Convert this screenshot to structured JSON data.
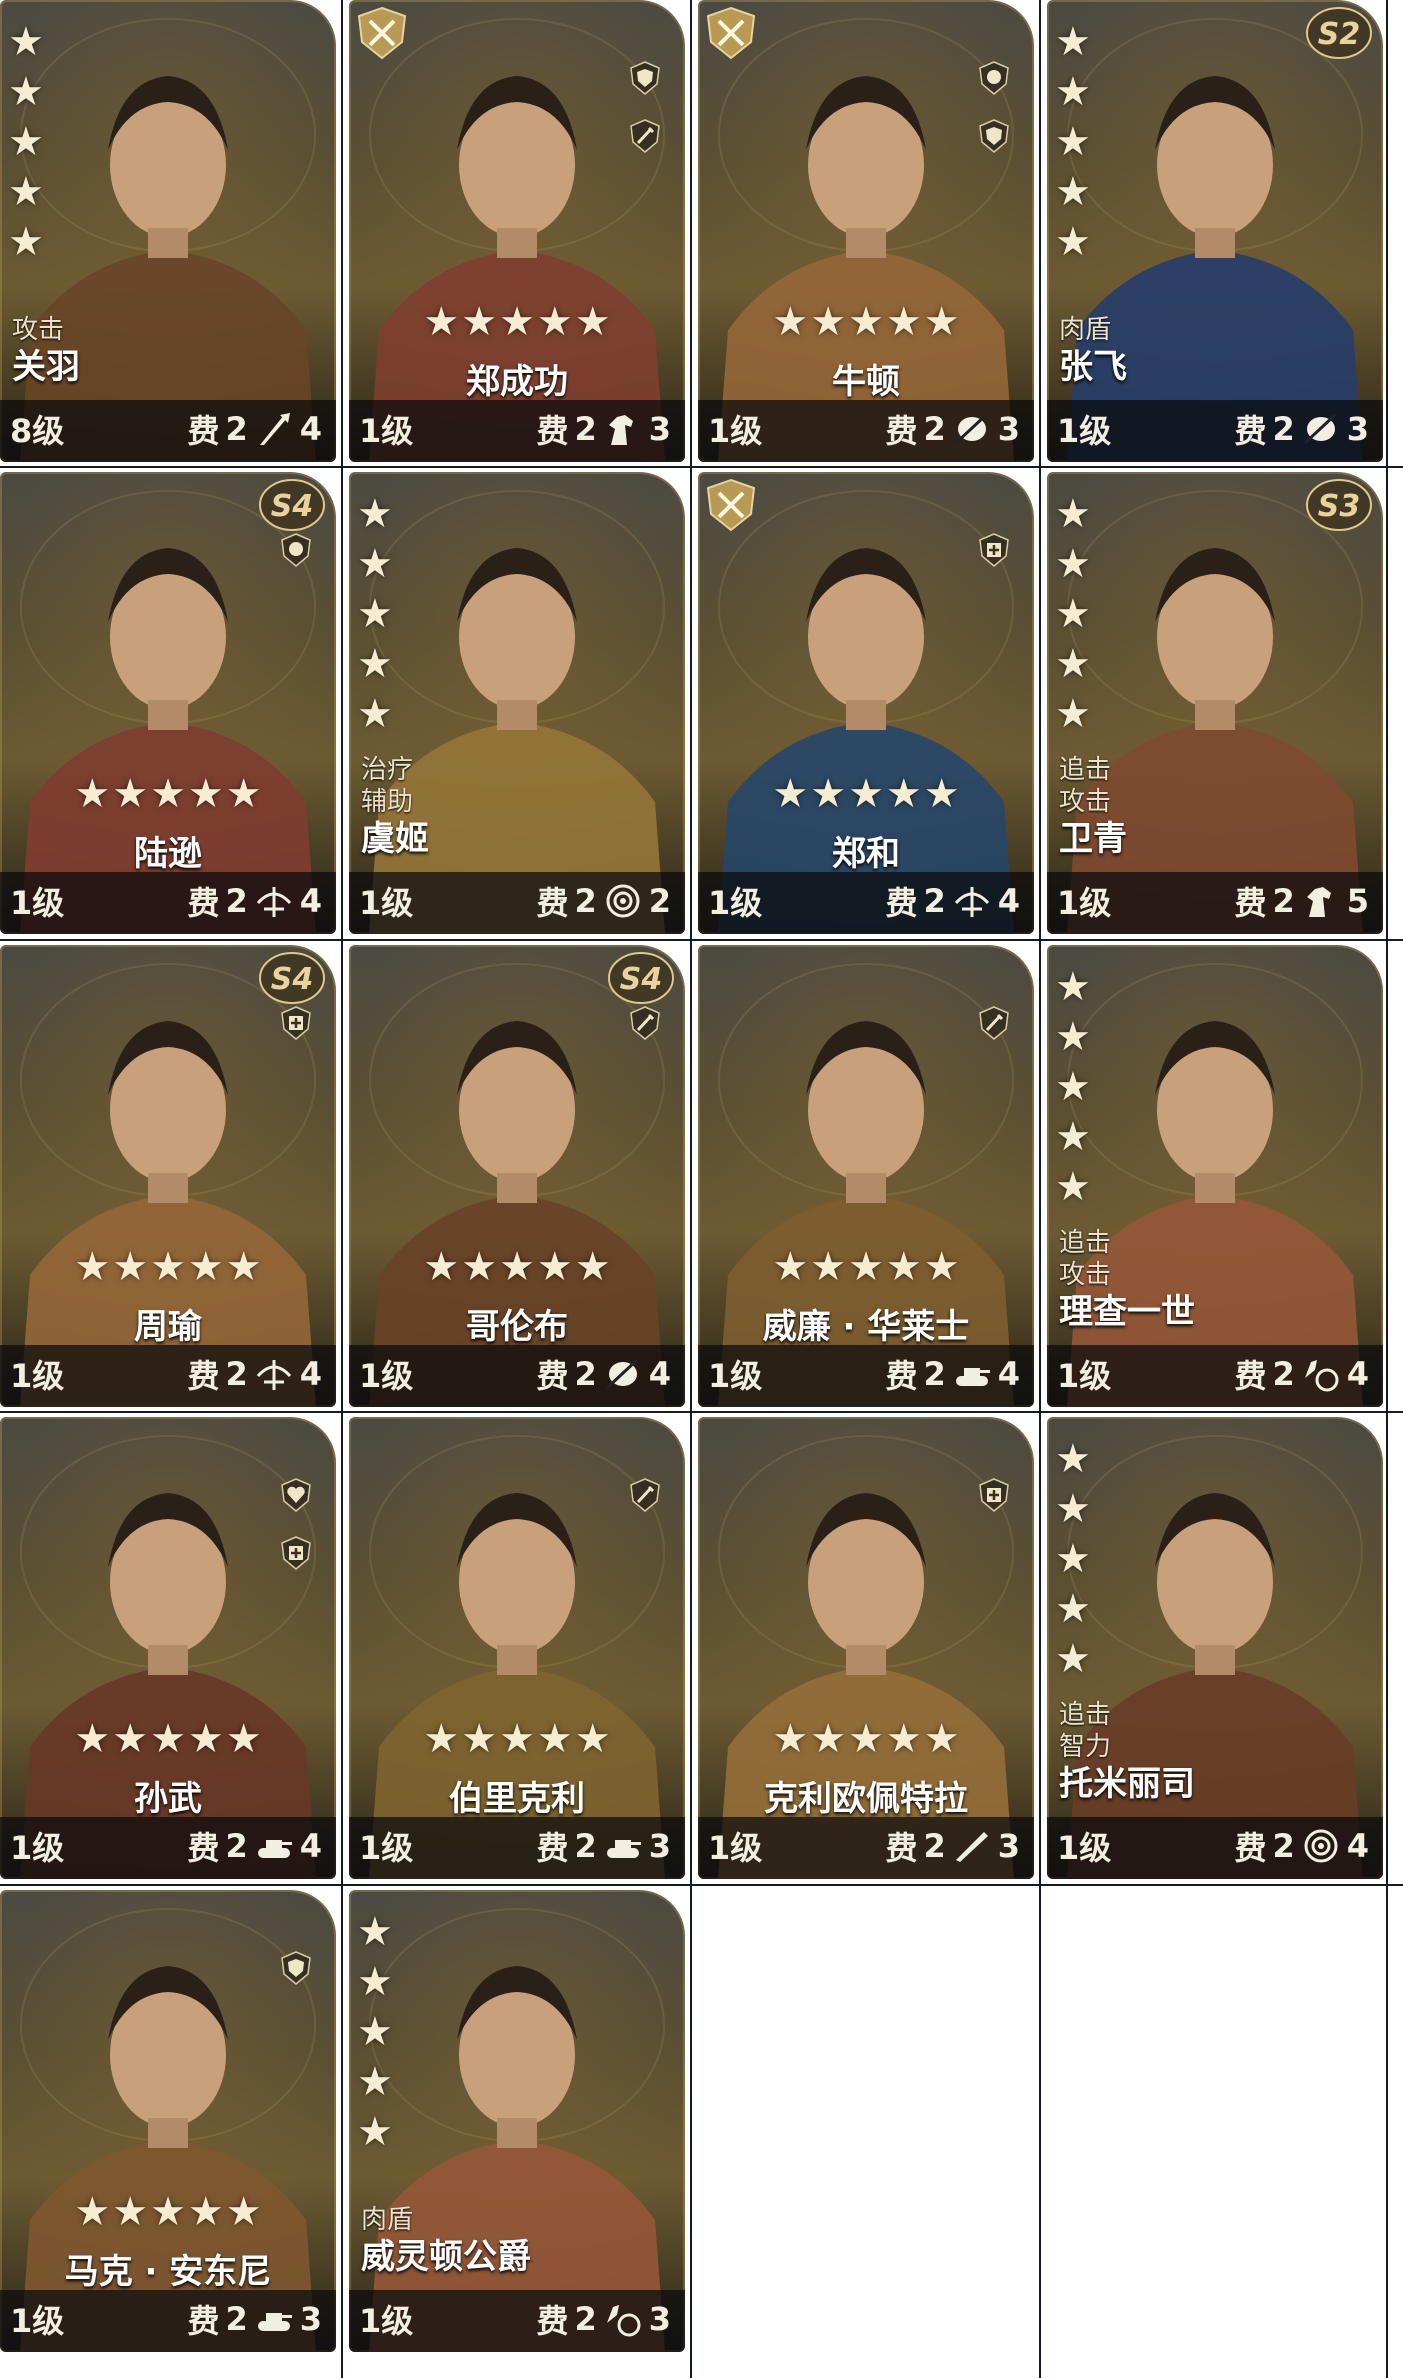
{
  "ui": {
    "cost_label": "费"
  },
  "cards": [
    {
      "name": "关羽",
      "level": "8级",
      "cost": "2",
      "unit_count": "4",
      "unit_icon": "spear-icon",
      "stars": 5,
      "star_layout": "column",
      "roles": [
        "攻击"
      ],
      "badge": "",
      "season": "",
      "traits": []
    },
    {
      "name": "郑成功",
      "level": "1级",
      "cost": "2",
      "unit_count": "3",
      "unit_icon": "horse-icon",
      "stars": 5,
      "star_layout": "row",
      "roles": [],
      "badge": "crossed-swords-icon",
      "season": "",
      "traits": [
        "shield-icon",
        "sword-icon"
      ]
    },
    {
      "name": "牛顿",
      "level": "1级",
      "cost": "2",
      "unit_count": "3",
      "unit_icon": "feather-blade-icon",
      "stars": 5,
      "star_layout": "row",
      "roles": [],
      "badge": "crossed-swords-icon",
      "season": "",
      "traits": [
        "head-icon",
        "shield-icon"
      ]
    },
    {
      "name": "张飞",
      "level": "1级",
      "cost": "2",
      "unit_count": "3",
      "unit_icon": "feather-blade-icon",
      "stars": 5,
      "star_layout": "column",
      "roles": [
        "肉盾"
      ],
      "badge": "",
      "season": "S2",
      "traits": []
    },
    {
      "name": "陆逊",
      "level": "1级",
      "cost": "2",
      "unit_count": "4",
      "unit_icon": "crossbow-icon",
      "stars": 5,
      "star_layout": "row",
      "roles": [],
      "badge": "",
      "season": "S4",
      "traits": [
        "head-icon"
      ]
    },
    {
      "name": "虞姬",
      "level": "1级",
      "cost": "2",
      "unit_count": "2",
      "unit_icon": "target-icon",
      "stars": 5,
      "star_layout": "column",
      "roles": [
        "治疗",
        "辅助"
      ],
      "badge": "",
      "season": "",
      "traits": []
    },
    {
      "name": "郑和",
      "level": "1级",
      "cost": "2",
      "unit_count": "4",
      "unit_icon": "crossbow-icon",
      "stars": 5,
      "star_layout": "row",
      "roles": [],
      "badge": "crossed-swords-icon",
      "season": "",
      "traits": [
        "shield-plus-icon"
      ]
    },
    {
      "name": "卫青",
      "level": "1级",
      "cost": "2",
      "unit_count": "5",
      "unit_icon": "horse-icon",
      "stars": 5,
      "star_layout": "column",
      "roles": [
        "追击",
        "攻击"
      ],
      "badge": "",
      "season": "S3",
      "traits": []
    },
    {
      "name": "周瑜",
      "level": "1级",
      "cost": "2",
      "unit_count": "4",
      "unit_icon": "crossbow-icon",
      "stars": 5,
      "star_layout": "row",
      "roles": [],
      "badge": "",
      "season": "S4",
      "traits": [
        "shield-plus-icon"
      ]
    },
    {
      "name": "哥伦布",
      "level": "1级",
      "cost": "2",
      "unit_count": "4",
      "unit_icon": "feather-blade-icon",
      "stars": 5,
      "star_layout": "row",
      "roles": [],
      "badge": "",
      "season": "S4",
      "traits": [
        "sword-icon"
      ]
    },
    {
      "name": "威廉 · 华莱士",
      "level": "1级",
      "cost": "2",
      "unit_count": "4",
      "unit_icon": "tank-icon",
      "stars": 5,
      "star_layout": "row",
      "roles": [],
      "badge": "",
      "season": "",
      "traits": [
        "sword-icon"
      ]
    },
    {
      "name": "理查一世",
      "level": "1级",
      "cost": "2",
      "unit_count": "4",
      "unit_icon": "chariot-icon",
      "stars": 5,
      "star_layout": "column",
      "roles": [
        "追击",
        "攻击"
      ],
      "badge": "",
      "season": "",
      "traits": []
    },
    {
      "name": "孙武",
      "level": "1级",
      "cost": "2",
      "unit_count": "4",
      "unit_icon": "tank-icon",
      "stars": 5,
      "star_layout": "row",
      "roles": [],
      "badge": "",
      "season": "",
      "traits": [
        "heart-icon",
        "shield-plus-icon"
      ]
    },
    {
      "name": "伯里克利",
      "level": "1级",
      "cost": "2",
      "unit_count": "3",
      "unit_icon": "tank-icon",
      "stars": 5,
      "star_layout": "row",
      "roles": [],
      "badge": "",
      "season": "",
      "traits": [
        "sword-icon"
      ]
    },
    {
      "name": "克利欧佩特拉",
      "level": "1级",
      "cost": "2",
      "unit_count": "3",
      "unit_icon": "rifle-icon",
      "stars": 5,
      "star_layout": "row",
      "roles": [],
      "badge": "",
      "season": "",
      "traits": [
        "shield-plus-icon"
      ]
    },
    {
      "name": "托米丽司",
      "level": "1级",
      "cost": "2",
      "unit_count": "4",
      "unit_icon": "target-icon",
      "stars": 5,
      "star_layout": "column",
      "roles": [
        "追击",
        "智力"
      ],
      "badge": "",
      "season": "",
      "traits": []
    },
    {
      "name": "马克 · 安东尼",
      "level": "1级",
      "cost": "2",
      "unit_count": "3",
      "unit_icon": "tank-icon",
      "stars": 5,
      "star_layout": "row",
      "roles": [],
      "badge": "",
      "season": "",
      "traits": [
        "shield-icon"
      ]
    },
    {
      "name": "威灵顿公爵",
      "level": "1级",
      "cost": "2",
      "unit_count": "3",
      "unit_icon": "chariot-icon",
      "stars": 5,
      "star_layout": "column",
      "roles": [
        "肉盾"
      ],
      "badge": "",
      "season": "",
      "traits": []
    }
  ]
}
